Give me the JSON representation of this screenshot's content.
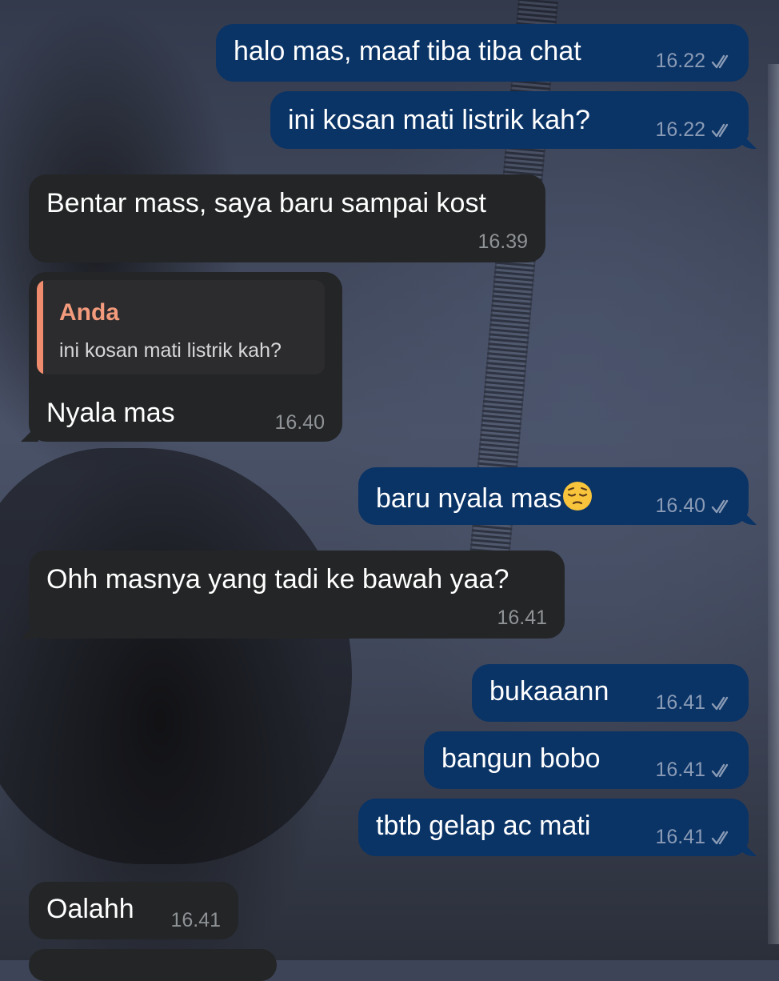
{
  "conversation": {
    "messages": [
      {
        "direction": "outgoing",
        "text": "halo mas, maaf tiba tiba chat",
        "time": "16.22",
        "status": "read"
      },
      {
        "direction": "outgoing",
        "text": "ini kosan mati listrik kah?",
        "time": "16.22",
        "status": "read"
      },
      {
        "direction": "incoming",
        "text": "Bentar mass, saya baru sampai kost",
        "time": "16.39"
      },
      {
        "direction": "incoming",
        "reply_to": {
          "author": "Anda",
          "text": "ini kosan mati listrik kah?"
        },
        "text": "Nyala mas",
        "time": "16.40"
      },
      {
        "direction": "outgoing",
        "text": "baru nyala mas",
        "emoji": "pensive-face",
        "time": "16.40",
        "status": "read"
      },
      {
        "direction": "incoming",
        "text": "Ohh masnya yang tadi ke bawah yaa?",
        "time": "16.41"
      },
      {
        "direction": "outgoing",
        "text": "bukaaann",
        "time": "16.41",
        "status": "read"
      },
      {
        "direction": "outgoing",
        "text": "bangun bobo",
        "time": "16.41",
        "status": "read"
      },
      {
        "direction": "outgoing",
        "text": "tbtb gelap ac mati",
        "time": "16.41",
        "status": "read"
      },
      {
        "direction": "incoming",
        "text": "Oalahh",
        "time": "16.41"
      }
    ]
  },
  "colors": {
    "outgoing_bubble": "#0a3366",
    "incoming_bubble": "#232526",
    "reply_accent": "#f08c6e",
    "meta_outgoing": "#8a9bb5",
    "meta_incoming": "#8f9396"
  },
  "icons": {
    "read_status": "double-check-icon",
    "emoji": "pensive-face-emoji"
  }
}
